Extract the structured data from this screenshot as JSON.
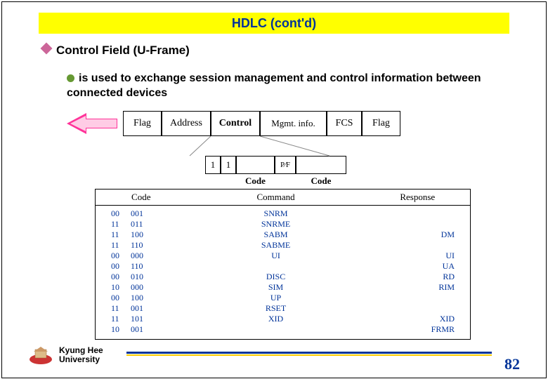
{
  "title": "HDLC (cont'd)",
  "bullet1": "Control Field (U-Frame)",
  "bullet2": "is used to exchange session management and control information between connected devices",
  "frame": {
    "flag1": "Flag",
    "address": "Address",
    "control": "Control",
    "mgmt": "Mgmt. info.",
    "fcs": "FCS",
    "flag2": "Flag"
  },
  "ctrl": {
    "one1": "1",
    "one2": "1",
    "pf": "P∕F",
    "label_left": "Code",
    "label_right": "Code"
  },
  "table": {
    "h_code": "Code",
    "h_cmd": "Command",
    "h_resp": "Response",
    "rows": [
      {
        "c1": "00",
        "c2": "001",
        "cmd": "SNRM",
        "resp": ""
      },
      {
        "c1": "11",
        "c2": "011",
        "cmd": "SNRME",
        "resp": ""
      },
      {
        "c1": "11",
        "c2": "100",
        "cmd": "SABM",
        "resp": "DM"
      },
      {
        "c1": "11",
        "c2": "110",
        "cmd": "SABME",
        "resp": ""
      },
      {
        "c1": "00",
        "c2": "000",
        "cmd": "UI",
        "resp": "UI"
      },
      {
        "c1": "00",
        "c2": "110",
        "cmd": "",
        "resp": "UA"
      },
      {
        "c1": "00",
        "c2": "010",
        "cmd": "DISC",
        "resp": "RD"
      },
      {
        "c1": "10",
        "c2": "000",
        "cmd": "SIM",
        "resp": "RIM"
      },
      {
        "c1": "00",
        "c2": "100",
        "cmd": "UP",
        "resp": ""
      },
      {
        "c1": "11",
        "c2": "001",
        "cmd": "RSET",
        "resp": ""
      },
      {
        "c1": "11",
        "c2": "101",
        "cmd": "XID",
        "resp": "XID"
      },
      {
        "c1": "10",
        "c2": "001",
        "cmd": "",
        "resp": "FRMR"
      }
    ]
  },
  "footer": {
    "uni1": "Kyung Hee",
    "uni2": "University"
  },
  "page": "82"
}
